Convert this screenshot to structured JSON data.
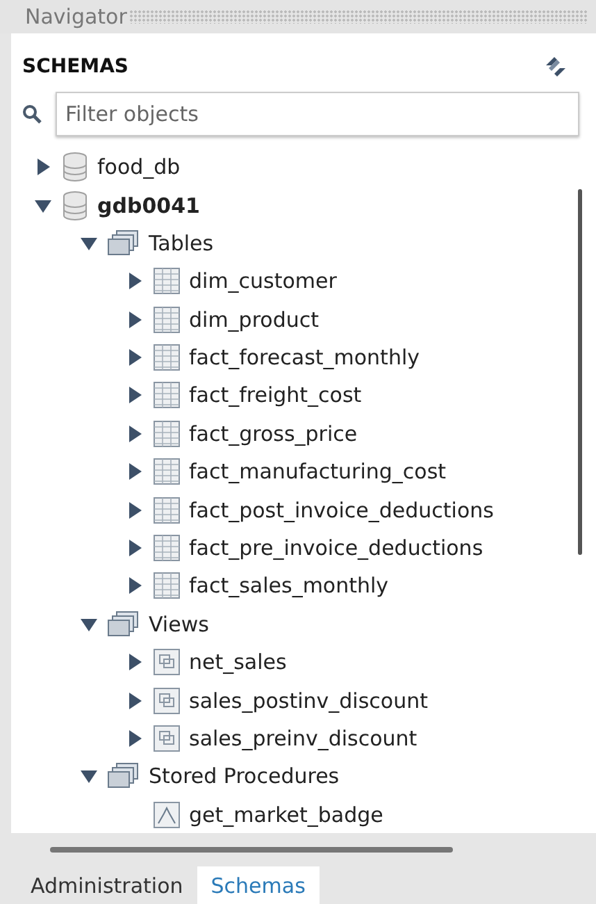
{
  "panel": {
    "title": "Navigator"
  },
  "section": {
    "title": "SCHEMAS"
  },
  "filter": {
    "placeholder": "Filter objects"
  },
  "tree": [
    {
      "kind": "schema",
      "label": "food_db",
      "expanded": false,
      "default": false
    },
    {
      "kind": "schema",
      "label": "gdb0041",
      "expanded": true,
      "default": true,
      "children": [
        {
          "kind": "folder",
          "label": "Tables",
          "expanded": true,
          "children": [
            {
              "kind": "table",
              "label": "dim_customer",
              "expanded": false
            },
            {
              "kind": "table",
              "label": "dim_product",
              "expanded": false
            },
            {
              "kind": "table",
              "label": "fact_forecast_monthly",
              "expanded": false
            },
            {
              "kind": "table",
              "label": "fact_freight_cost",
              "expanded": false
            },
            {
              "kind": "table",
              "label": "fact_gross_price",
              "expanded": false
            },
            {
              "kind": "table",
              "label": "fact_manufacturing_cost",
              "expanded": false
            },
            {
              "kind": "table",
              "label": "fact_post_invoice_deductions",
              "expanded": false
            },
            {
              "kind": "table",
              "label": "fact_pre_invoice_deductions",
              "expanded": false
            },
            {
              "kind": "table",
              "label": "fact_sales_monthly",
              "expanded": false
            }
          ]
        },
        {
          "kind": "folder",
          "label": "Views",
          "expanded": true,
          "children": [
            {
              "kind": "view",
              "label": "net_sales",
              "expanded": false
            },
            {
              "kind": "view",
              "label": "sales_postinv_discount",
              "expanded": false
            },
            {
              "kind": "view",
              "label": "sales_preinv_discount",
              "expanded": false
            }
          ]
        },
        {
          "kind": "folder",
          "label": "Stored Procedures",
          "expanded": true,
          "children": [
            {
              "kind": "routine",
              "label": "get_market_badge"
            }
          ]
        }
      ]
    }
  ],
  "tabs": [
    {
      "label": "Administration",
      "selected": false
    },
    {
      "label": "Schemas",
      "selected": true
    }
  ]
}
